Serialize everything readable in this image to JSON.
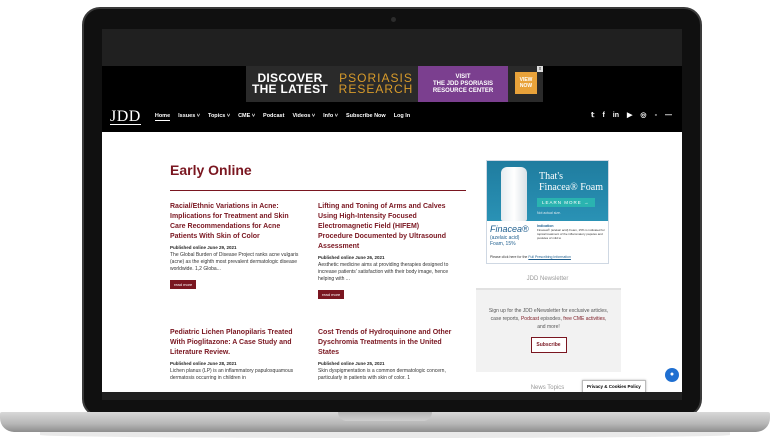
{
  "ad_banner": {
    "discover": "DISCOVER",
    "the_latest": "THE LATEST",
    "psoriasis": "PSORIASIS",
    "research": "RESEARCH",
    "visit": "VISIT",
    "center_name_1": "THE JDD PSORIASIS",
    "center_name_2": "RESOURCE CENTER",
    "view_now_1": "VIEW",
    "view_now_2": "NOW",
    "close": "x"
  },
  "nav": {
    "logo": "JDD",
    "links": [
      "Home",
      "Issues ˅",
      "Topics ˅",
      "CME ˅",
      "Podcast",
      "Videos ˅",
      "Info ˅",
      "Subscribe Now",
      "Log In"
    ],
    "social": [
      "𝕥",
      "f",
      "in",
      "▶",
      "◎",
      "▫",
      "—"
    ]
  },
  "main": {
    "title": "Early Online",
    "articles": [
      {
        "title": "Racial/Ethnic Variations in Acne: Implications for Treatment and Skin Care Recommendations for Acne Patients With Skin of Color",
        "date": "Published online June 29, 2021",
        "excerpt": "The Global Burden of Disease Project ranks acne vulgaris (acne) as the eighth most prevalent dermatologic disease worldwide. 1,2 Globa...",
        "read_more": "read more"
      },
      {
        "title": "Lifting and Toning of Arms and Calves Using High-Intensity Focused Electromagnetic Field (HIFEM) Procedure Documented by Ultrasound Assessment",
        "date": "Published online June 26, 2021",
        "excerpt": "Aesthetic medicine aims at providing therapies designed to increase patients' satisfaction with their body image, hence helping with ...",
        "read_more": "read more"
      },
      {
        "title": "Pediatric Lichen Planopilaris Treated With Pioglitazone: A Case Study and Literature Review.",
        "date": "Published online June 28, 2021",
        "excerpt": "Lichen planus (LP) is an inflammatory papulosquamous dermatosis occurring in children in"
      },
      {
        "title": "Cost Trends of Hydroquinone and Other Dyschromia Treatments in the United States",
        "date": "Published online June 25, 2021",
        "excerpt": "Skin dyspigmentation is a common dermatologic concern, particularly in patients with skin of color. 1"
      }
    ]
  },
  "sidebar": {
    "ad": {
      "headline_1": "That's",
      "headline_2": "Finacea® Foam",
      "learn_more": "LEARN MORE →",
      "not_actual": "Not actual size.",
      "brand": "Finacea®",
      "brand_sub_1": "(azelaic acid)",
      "brand_sub_2": "Foam, 15%",
      "indication_label": "Indication",
      "indication_text": "Finacea® (azelaic acid) Foam, 15% is indicated for topical treatment of the inflammatory papules and pustules of mild to",
      "click_text": "Please click here for the ",
      "click_link": "Full Prescribing Information"
    },
    "newsletter": {
      "heading": "JDD Newsletter",
      "text_1": "Sign up for the JDD eNewsletter for exclusive articles, case reports, ",
      "highlight_1": "Podcast",
      "text_2": " episodes, ",
      "highlight_2": "free CME activities",
      "text_3": ", and more!",
      "button": "Subscribe"
    },
    "topics_heading": "News Topics"
  },
  "privacy_label": "Privacy & Cookies Policy",
  "chat_icon": "●"
}
